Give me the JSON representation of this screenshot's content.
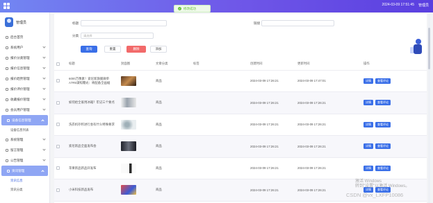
{
  "topbar": {
    "datetime": "2024-03-09 17:51:45",
    "user": "管理员"
  },
  "toast": {
    "message": "修改成功"
  },
  "sidebar": {
    "username": "管理员",
    "items": [
      {
        "label": "后台首页",
        "expand": false
      },
      {
        "label": "系统用户",
        "expand": true
      },
      {
        "label": "报价分类管理",
        "expand": true
      },
      {
        "label": "报价信息管理",
        "expand": true
      },
      {
        "label": "报价趋势管理",
        "expand": true
      },
      {
        "label": "报价评价管理",
        "expand": true
      },
      {
        "label": "收藏报价管理",
        "expand": true
      },
      {
        "label": "会员用户管理",
        "expand": true
      },
      {
        "label": "设备信息管理",
        "expand": true,
        "active": true
      }
    ],
    "sub1": [
      "设备信息列表"
    ],
    "items2": [
      {
        "label": "系统管理",
        "expand": true
      },
      {
        "label": "留言管理",
        "expand": true
      },
      {
        "label": "公告管理",
        "expand": true
      },
      {
        "label": "资讯管理",
        "expand": true,
        "active": true
      }
    ],
    "sub2": [
      "资讯信息",
      "资讯分类"
    ]
  },
  "search": {
    "title_label": "标题",
    "title_value": "",
    "link_label": "链接",
    "link_value": "",
    "category_label": "分类",
    "category_placeholder": "请选择",
    "buttons": {
      "search": "查询",
      "reset": "重置",
      "delete": "删除",
      "add": "添加"
    }
  },
  "table": {
    "headers": [
      "",
      "标题",
      "封面图",
      "文章分类",
      "标签",
      "创建时间",
      "更新时间",
      "操作"
    ],
    "rows": [
      {
        "title": "6000万像素！索尼新旗舰微单A7R5谍照曝光：将配备全画幅",
        "category": "商品",
        "tag": "",
        "created": "2024-03-09 17:26:21",
        "updated": "2024-03-09 17:47:01"
      },
      {
        "title": "如何给全家用冰箱？牢记三个要点",
        "category": "商品",
        "tag": "",
        "created": "2024-03-09 17:26:21",
        "updated": "2024-03-09 17:26:21"
      },
      {
        "title": "洗衣机存积进行会有什么特殊要求",
        "category": "商品",
        "tag": "",
        "created": "2024-03-09 17:26:21",
        "updated": "2024-03-09 17:26:21"
      },
      {
        "title": "索尼新品全面发布会",
        "category": "商品",
        "tag": "",
        "created": "2024-03-09 17:26:21",
        "updated": "2024-03-09 17:26:21"
      },
      {
        "title": "苹果新品新品开发布",
        "category": "商品",
        "tag": "",
        "created": "2024-03-09 17:26:21",
        "updated": "2024-03-09 17:26:21"
      },
      {
        "title": "小米科技新品发布",
        "category": "商品",
        "tag": "",
        "created": "2024-03-09 17:26:21",
        "updated": "2024-03-09 17:26:21"
      }
    ],
    "op_detail": "详情",
    "op_comments": "查看评论"
  },
  "watermark": {
    "line1": "激活 Windows",
    "line2": "转到\"设置\"以激活 Windows。"
  },
  "csdn_mark": "CSDN @vx_LXFP10086",
  "colors": {
    "primary": "#3a6fe8",
    "danger": "#f26a6a",
    "sidebar_active": "#8fa6f4",
    "header_start": "#7286f2",
    "header_end": "#5a3fe0"
  }
}
